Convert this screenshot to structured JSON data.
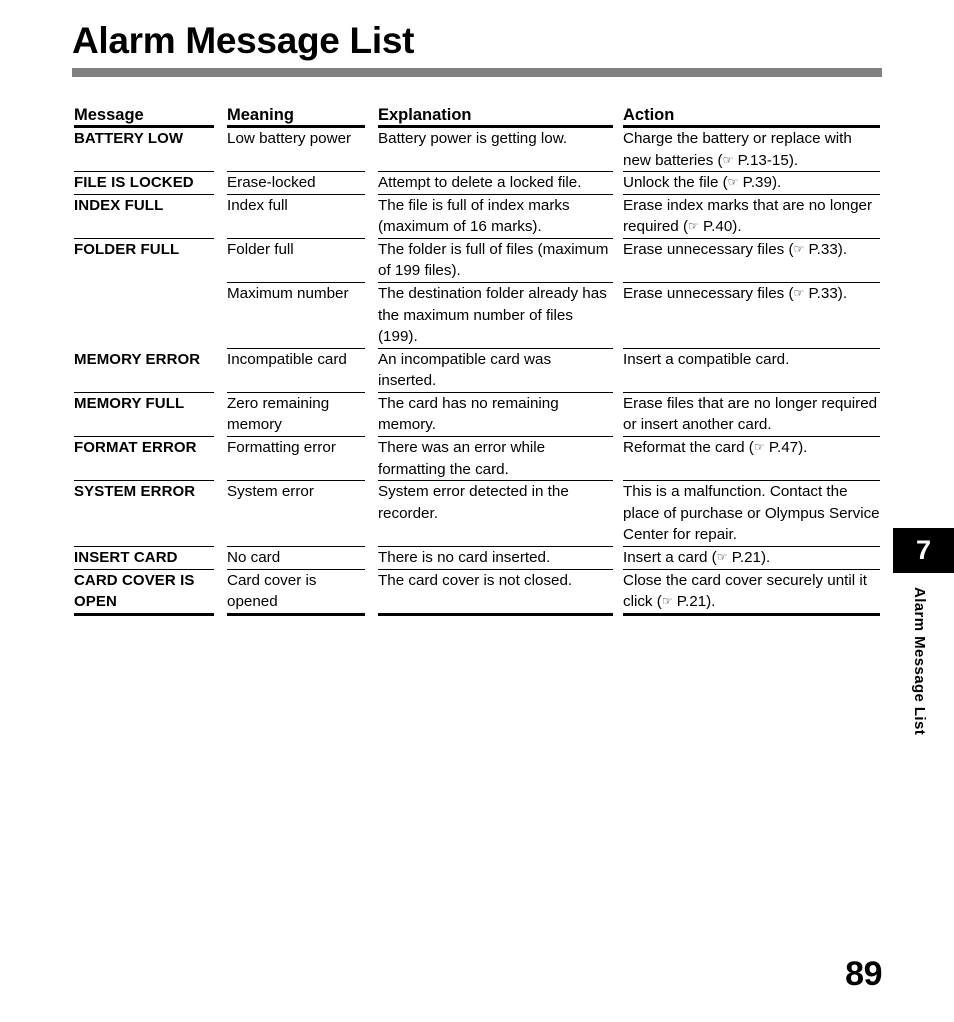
{
  "page": {
    "title": "Alarm Message List",
    "number": "89"
  },
  "side_tab": {
    "chapter": "7",
    "label": "Alarm Message List"
  },
  "table": {
    "headers": {
      "message": "Message",
      "meaning": "Meaning",
      "explanation": "Explanation",
      "action": "Action"
    },
    "rows": [
      {
        "message": "BATTERY LOW",
        "meaning": "Low battery power",
        "explanation": "Battery power is getting low.",
        "action_before": "Charge the battery or replace with new batteries (",
        "action_icon": "☞",
        "action_after": " P.13-15)."
      },
      {
        "message": "FILE IS LOCKED",
        "meaning": "Erase-locked",
        "explanation": "Attempt to delete a locked file.",
        "action_before": "Unlock the file (",
        "action_icon": "☞",
        "action_after": " P.39)."
      },
      {
        "message": "INDEX FULL",
        "meaning": "Index full",
        "explanation": "The file is full of index marks (maximum of 16 marks).",
        "action_before": "Erase index marks that are no longer required (",
        "action_icon": "☞",
        "action_after": " P.40)."
      },
      {
        "message": "FOLDER FULL",
        "meaning": "Folder full",
        "explanation": "The folder is full of files (maximum of 199 files).",
        "action_before": "Erase unnecessary files (",
        "action_icon": "☞",
        "action_after": " P.33)."
      },
      {
        "message": "",
        "meaning": "Maximum number",
        "explanation": "The destination folder already has the maximum number of files (199).",
        "action_before": "Erase unnecessary files (",
        "action_icon": "☞",
        "action_after": " P.33)."
      },
      {
        "message": "MEMORY ERROR",
        "meaning": "Incompatible card",
        "explanation": "An incompatible card was inserted.",
        "action_before": "Insert a compatible card.",
        "action_icon": "",
        "action_after": ""
      },
      {
        "message": "MEMORY FULL",
        "meaning": "Zero remaining memory",
        "explanation": "The card has no remaining memory.",
        "action_before": "Erase files that are no longer required or insert another card.",
        "action_icon": "",
        "action_after": ""
      },
      {
        "message": "FORMAT ERROR",
        "meaning": "Formatting error",
        "explanation": "There was an error while formatting the card.",
        "action_before": "Reformat the card (",
        "action_icon": "☞",
        "action_after": " P.47)."
      },
      {
        "message": "SYSTEM ERROR",
        "meaning": "System error",
        "explanation": "System error detected in the recorder.",
        "action_before": "This is a malfunction. Contact the place of purchase or Olympus Service Center for repair.",
        "action_icon": "",
        "action_after": ""
      },
      {
        "message": "INSERT CARD",
        "meaning": "No card",
        "explanation": "There is no card inserted.",
        "action_before": "Insert a card (",
        "action_icon": "☞",
        "action_after": " P.21)."
      },
      {
        "message": "CARD  COVER IS OPEN",
        "meaning": "Card cover is opened",
        "explanation": "The card cover is not closed.",
        "action_before": "Close the card cover securely until it click (",
        "action_icon": "☞",
        "action_after": " P.21)."
      }
    ]
  },
  "colors": {
    "title_rule": "#808080",
    "text": "#000000",
    "tab_background": "#000000",
    "tab_text": "#ffffff"
  }
}
